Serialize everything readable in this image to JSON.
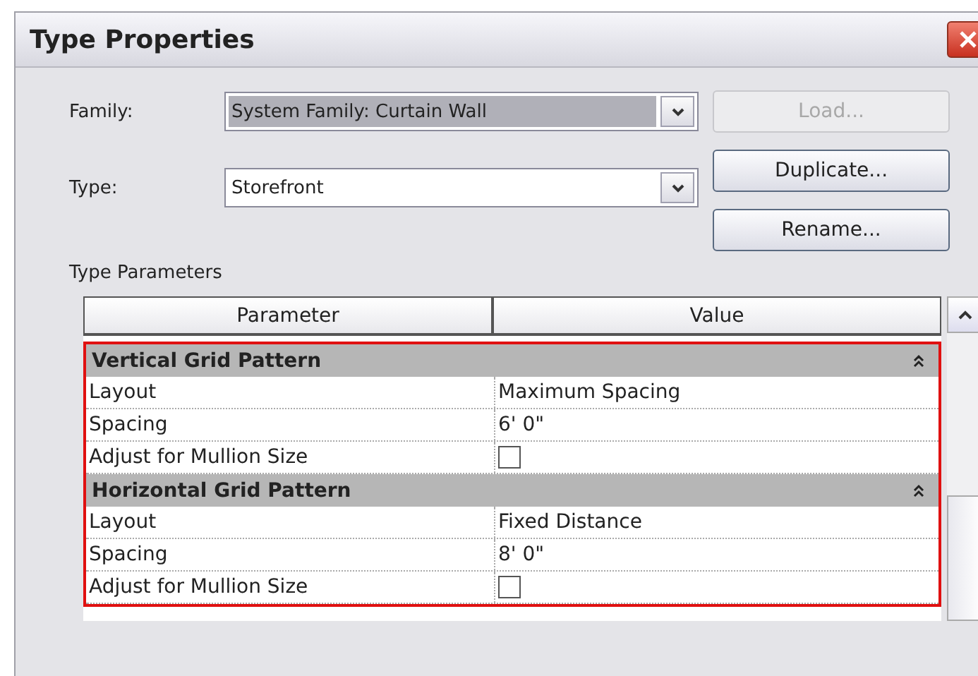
{
  "window": {
    "title": "Type Properties"
  },
  "fields": [
    {
      "label": "Family:",
      "value": "System Family: Curtain Wall",
      "disabled": true
    },
    {
      "label": "Type:",
      "value": "Storefront",
      "disabled": false
    }
  ],
  "buttons": [
    {
      "label": "Load...",
      "disabled": true
    },
    {
      "label": "Duplicate...",
      "disabled": false
    },
    {
      "label": "Rename...",
      "disabled": false
    }
  ],
  "section_label": "Type Parameters",
  "table": {
    "columns": [
      "Parameter",
      "Value"
    ],
    "groups": [
      {
        "title": "Vertical Grid Pattern",
        "expanded": true,
        "rows": [
          {
            "kind": "text",
            "parameter": "Layout",
            "value": "Maximum Spacing"
          },
          {
            "kind": "text",
            "parameter": "Spacing",
            "value": "6'  0\""
          },
          {
            "kind": "checkbox",
            "parameter": "Adjust for Mullion Size",
            "checked": false
          }
        ]
      },
      {
        "title": "Horizontal Grid Pattern",
        "expanded": true,
        "rows": [
          {
            "kind": "text",
            "parameter": "Layout",
            "value": "Fixed Distance"
          },
          {
            "kind": "text",
            "parameter": "Spacing",
            "value": "8'  0\""
          },
          {
            "kind": "checkbox",
            "parameter": "Adjust for Mullion Size",
            "checked": false
          }
        ]
      }
    ]
  }
}
